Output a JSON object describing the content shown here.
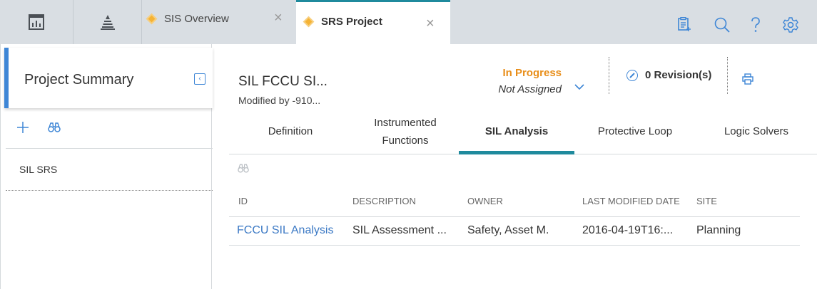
{
  "topbar": {
    "tabs": [
      {
        "label": "SIS Overview",
        "icon": "diamond-icon"
      },
      {
        "label": "SRS Project",
        "icon": "diamond-icon",
        "active": true
      }
    ],
    "close_glyph": "×",
    "toolbar_icons": [
      "dashboard-icon",
      "pyramid-icon",
      "notes-icon",
      "search-icon",
      "help-icon",
      "settings-icon"
    ]
  },
  "left": {
    "title": "Project Summary",
    "collapse_glyph": "‹",
    "items": [
      {
        "label": "SIL SRS"
      }
    ]
  },
  "record": {
    "title": "SIL FCCU SI...",
    "subtitle": "Modified by -910...",
    "state": "In Progress",
    "assignment": "Not Assigned",
    "revisions": "0 Revision(s)"
  },
  "tabs": [
    {
      "label": "Definition"
    },
    {
      "label": "Instrumented\nFunctions"
    },
    {
      "label": "SIL Analysis",
      "active": true
    },
    {
      "label": "Protective Loop"
    },
    {
      "label": "Logic Solvers"
    }
  ],
  "grid": {
    "columns": [
      "ID",
      "DESCRIPTION",
      "OWNER",
      "LAST MODIFIED DATE",
      "SITE"
    ],
    "rows": [
      [
        "FCCU SIL Analysis",
        "SIL Assessment ...",
        "Safety, Asset M.",
        "2016-04-19T16:...",
        "Planning"
      ]
    ]
  },
  "colors": {
    "accent_teal": "#1f8a9d",
    "accent_blue": "#3e86d6",
    "state_orange": "#e88e1a",
    "link_blue": "#3a78c4",
    "tab_diamond": "#f5b335"
  }
}
